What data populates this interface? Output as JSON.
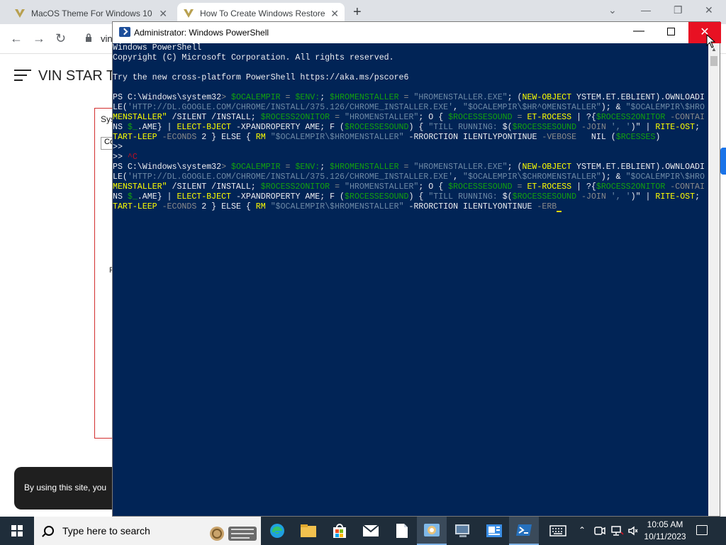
{
  "browser": {
    "tabs": [
      {
        "title": "MacOS Theme For Windows 10"
      },
      {
        "title": "How To Create Windows Restore"
      }
    ],
    "new_tab": "+",
    "url": "vin",
    "site_title": "VIN STAR T",
    "sys_label": "Sys",
    "co_label": "Co",
    "r_label": "F",
    "cookie_text": "By using this site, you"
  },
  "powershell": {
    "title": "Administrator: Windows PowerShell",
    "lines": [
      [
        {
          "t": "Windows PowerShell",
          "c": "w"
        }
      ],
      [
        {
          "t": "Copyright (C) Microsoft Corporation. All rights reserved.",
          "c": "w"
        }
      ],
      [
        {
          "t": "",
          "c": "w"
        }
      ],
      [
        {
          "t": "Try the new cross-platform PowerShell https://aka.ms/pscore6",
          "c": "w"
        }
      ],
      [
        {
          "t": "",
          "c": "w"
        }
      ],
      [
        {
          "t": "PS C:\\Windows\\system32",
          "c": "w"
        },
        {
          "t": "> ",
          "c": "gr"
        },
        {
          "t": "$OCALEMPIR",
          "c": "g"
        },
        {
          "t": " = ",
          "c": "gr"
        },
        {
          "t": "$ENV:",
          "c": "g"
        },
        {
          "t": "; ",
          "c": "w"
        },
        {
          "t": "$HROMENSTALLER",
          "c": "g"
        },
        {
          "t": " = ",
          "c": "gr"
        },
        {
          "t": "\"HROMENSTALLER.EXE\"",
          "c": "dg"
        },
        {
          "t": "; (",
          "c": "w"
        },
        {
          "t": "NEW-OBJECT",
          "c": "y"
        },
        {
          "t": " YSTEM.ET.EBLIENT).OWNLOADI",
          "c": "w"
        }
      ],
      [
        {
          "t": "LE(",
          "c": "w"
        },
        {
          "t": "'HTTP://DL.GOOGLE.COM/CHROME/INSTALL/375.126/CHROME_INSTALLER.EXE'",
          "c": "dg"
        },
        {
          "t": ", ",
          "c": "w"
        },
        {
          "t": "\"$OCALEMPIR\\$HR^OMENSTALLER\"",
          "c": "dg"
        },
        {
          "t": "); & ",
          "c": "w"
        },
        {
          "t": "\"$OCALEMPIR\\$HRO",
          "c": "dg"
        }
      ],
      [
        {
          "t": "MENSTALLER\"",
          "c": "y"
        },
        {
          "t": " /SILENT /INSTALL; ",
          "c": "w"
        },
        {
          "t": "$ROCESS2ONITOR",
          "c": "g"
        },
        {
          "t": " = ",
          "c": "gr"
        },
        {
          "t": "\"HROMENSTALLER\"",
          "c": "dg"
        },
        {
          "t": "; O { ",
          "c": "w"
        },
        {
          "t": "$ROCESSESOUND",
          "c": "g"
        },
        {
          "t": " = ",
          "c": "gr"
        },
        {
          "t": "ET-ROCESS",
          "c": "y"
        },
        {
          "t": " | ?{",
          "c": "w"
        },
        {
          "t": "$ROCESS2ONITOR",
          "c": "g"
        },
        {
          "t": " -CONTAI",
          "c": "gr"
        }
      ],
      [
        {
          "t": "NS ",
          "c": "w"
        },
        {
          "t": "$_",
          "c": "g"
        },
        {
          "t": ".AME} | ",
          "c": "w"
        },
        {
          "t": "ELECT-BJECT",
          "c": "y"
        },
        {
          "t": " -XPANDROPERTY AME; F (",
          "c": "w"
        },
        {
          "t": "$ROCESSESOUND",
          "c": "g"
        },
        {
          "t": ") { ",
          "c": "w"
        },
        {
          "t": "\"TILL RUNNING: ",
          "c": "dg"
        },
        {
          "t": "$(",
          "c": "w"
        },
        {
          "t": "$ROCESSESOUND",
          "c": "g"
        },
        {
          "t": " -JOIN ",
          "c": "gr"
        },
        {
          "t": "', '",
          "c": "dg"
        },
        {
          "t": ")\"",
          "c": "w"
        },
        {
          "t": " | ",
          "c": "w"
        },
        {
          "t": "RITE-OST",
          "c": "y"
        },
        {
          "t": ";",
          "c": "w"
        }
      ],
      [
        {
          "t": "TART-LEEP",
          "c": "y"
        },
        {
          "t": " -ECONDS",
          "c": "gr"
        },
        {
          "t": " 2 } ELSE { ",
          "c": "w"
        },
        {
          "t": "RM",
          "c": "y"
        },
        {
          "t": " ",
          "c": "w"
        },
        {
          "t": "\"$OCALEMPIR\\$HROMENSTALLER\"",
          "c": "dg"
        },
        {
          "t": " -RRORCTION ILENTLYPONTINUE ",
          "c": "w"
        },
        {
          "t": "-VEBOSE",
          "c": "gr"
        },
        {
          "t": "   NIL (",
          "c": "w"
        },
        {
          "t": "$RCESSES",
          "c": "g"
        },
        {
          "t": ")",
          "c": "w"
        }
      ],
      [
        {
          "t": ">>",
          "c": "w"
        }
      ],
      [
        {
          "t": ">> ",
          "c": "w"
        },
        {
          "t": "^C",
          "c": "r"
        }
      ],
      [
        {
          "t": "PS C:\\Windows\\system32",
          "c": "w"
        },
        {
          "t": "> ",
          "c": "gr"
        },
        {
          "t": "$OCALEMPIR",
          "c": "g"
        },
        {
          "t": " = ",
          "c": "gr"
        },
        {
          "t": "$ENV:",
          "c": "g"
        },
        {
          "t": "; ",
          "c": "w"
        },
        {
          "t": "$HROMENSTALLER",
          "c": "g"
        },
        {
          "t": " = ",
          "c": "gr"
        },
        {
          "t": "\"HROMENSTALLER.EXE\"",
          "c": "dg"
        },
        {
          "t": "; (",
          "c": "w"
        },
        {
          "t": "NEW-OBJECT",
          "c": "y"
        },
        {
          "t": " YSTEM.ET.EBLIENT).OWNLOADI",
          "c": "w"
        }
      ],
      [
        {
          "t": "LE(",
          "c": "w"
        },
        {
          "t": "'HTTP://DL.GOOGLE.COM/CHROME/INSTALL/375.126/CHROME_INSTALLER.EXE'",
          "c": "dg"
        },
        {
          "t": ", ",
          "c": "w"
        },
        {
          "t": "\"$OCALEMPIR\\$CHROMENSTALLER\"",
          "c": "dg"
        },
        {
          "t": "); & ",
          "c": "w"
        },
        {
          "t": "\"$OCALEMPIR\\$HRO",
          "c": "dg"
        }
      ],
      [
        {
          "t": "MENSTALLER\"",
          "c": "y"
        },
        {
          "t": " /SILENT /INSTALL; ",
          "c": "w"
        },
        {
          "t": "$ROCESS2ONITOR",
          "c": "g"
        },
        {
          "t": " = ",
          "c": "gr"
        },
        {
          "t": "\"HROMENSTALLER\"",
          "c": "dg"
        },
        {
          "t": "; O { ",
          "c": "w"
        },
        {
          "t": "$ROCESSESOUND",
          "c": "g"
        },
        {
          "t": " = ",
          "c": "gr"
        },
        {
          "t": "ET-ROCESS",
          "c": "y"
        },
        {
          "t": " | ?{",
          "c": "w"
        },
        {
          "t": "$ROCESS2ONITOR",
          "c": "g"
        },
        {
          "t": " -CONTAI",
          "c": "gr"
        }
      ],
      [
        {
          "t": "NS ",
          "c": "w"
        },
        {
          "t": "$_",
          "c": "g"
        },
        {
          "t": ".AME} | ",
          "c": "w"
        },
        {
          "t": "ELECT-BJECT",
          "c": "y"
        },
        {
          "t": " -XPANDROPERTY AME; F (",
          "c": "w"
        },
        {
          "t": "$ROCESSESOUND",
          "c": "g"
        },
        {
          "t": ") { ",
          "c": "w"
        },
        {
          "t": "\"TILL RUNNING: ",
          "c": "dg"
        },
        {
          "t": "$(",
          "c": "w"
        },
        {
          "t": "$ROCESSESOUND",
          "c": "g"
        },
        {
          "t": " -JOIN ",
          "c": "gr"
        },
        {
          "t": "', '",
          "c": "dg"
        },
        {
          "t": ")\"",
          "c": "w"
        },
        {
          "t": " | ",
          "c": "w"
        },
        {
          "t": "RITE-OST",
          "c": "y"
        },
        {
          "t": ";",
          "c": "w"
        }
      ],
      [
        {
          "t": "TART-LEEP",
          "c": "y"
        },
        {
          "t": " -ECONDS",
          "c": "gr"
        },
        {
          "t": " 2 } ELSE { ",
          "c": "w"
        },
        {
          "t": "RM",
          "c": "y"
        },
        {
          "t": " ",
          "c": "w"
        },
        {
          "t": "\"$OCALEMPIR\\$HROMENSTALLER\"",
          "c": "dg"
        },
        {
          "t": " -RRORCTION ILENTLYONTINUE ",
          "c": "w"
        },
        {
          "t": "-ERB",
          "c": "gr"
        },
        {
          "t": "",
          "c": "cur"
        }
      ]
    ]
  },
  "taskbar": {
    "search_placeholder": "Type here to search",
    "time": "10:05 AM",
    "date": "10/11/2023",
    "apps": [
      "edge-icon",
      "file-explorer-icon",
      "store-icon",
      "mail-icon",
      "notepad-icon",
      "control-panel-icon",
      "device-manager-icon",
      "system-info-icon",
      "powershell-icon"
    ]
  },
  "colors": {
    "ps_background": "#012456",
    "ps_yellow": "#ffff00",
    "ps_green": "#13a10e",
    "close_red": "#e81123",
    "taskbar": "#1f2d3a"
  }
}
